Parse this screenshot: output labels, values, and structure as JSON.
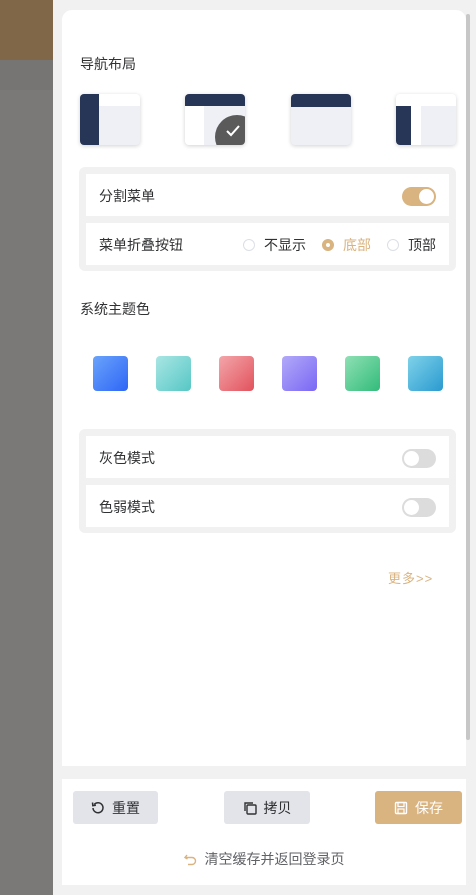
{
  "nav_layout": {
    "title": "导航布局",
    "selected": "top-left-mixed"
  },
  "options": {
    "split_menu": {
      "label": "分割菜单",
      "enabled": true
    },
    "collapse_button": {
      "label": "菜单折叠按钮",
      "choices": [
        "不显示",
        "底部",
        "顶部"
      ],
      "selected": "底部"
    }
  },
  "theme": {
    "title": "系统主题色",
    "colors": [
      {
        "name": "blue",
        "from": "#6aa3fb",
        "to": "#2e66f6"
      },
      {
        "name": "teal",
        "from": "#a9e6e4",
        "to": "#56c7c5"
      },
      {
        "name": "red",
        "from": "#f3a6ab",
        "to": "#e2525c"
      },
      {
        "name": "purple",
        "from": "#b2aaf9",
        "to": "#7a67f4"
      },
      {
        "name": "green",
        "from": "#8fe0b4",
        "to": "#32bb7a"
      },
      {
        "name": "cyan",
        "from": "#7fd2e9",
        "to": "#2a9ad0"
      }
    ]
  },
  "modes": {
    "gray": {
      "label": "灰色模式",
      "enabled": false
    },
    "weak": {
      "label": "色弱模式",
      "enabled": false
    }
  },
  "more_link": "更多>>",
  "footer": {
    "reset_label": "重置",
    "copy_label": "拷贝",
    "save_label": "保存",
    "clear_cache_label": "清空缓存并返回登录页"
  },
  "colors": {
    "accent": "#d9b380",
    "navy": "#273556"
  }
}
